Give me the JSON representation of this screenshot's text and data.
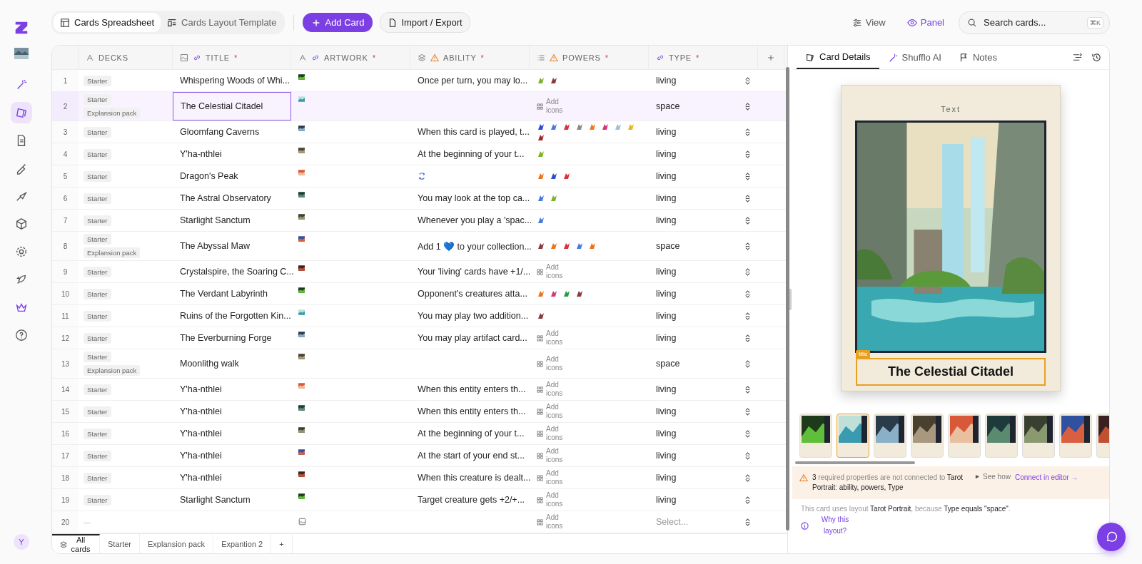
{
  "sidebar": {
    "items": [
      {
        "selected": false
      },
      {
        "selected": true
      },
      {
        "selected": false
      },
      {
        "selected": false
      },
      {
        "selected": false
      },
      {
        "selected": false
      },
      {
        "selected": false
      },
      {
        "selected": false
      },
      {
        "selected": false
      },
      {
        "selected": false
      }
    ],
    "avatar": "Y"
  },
  "views": [
    {
      "label": "Cards Spreadsheet",
      "selected": true
    },
    {
      "label": "Cards Layout Template",
      "selected": false
    }
  ],
  "add_button": "Add Card",
  "import_button": "Import / Export",
  "view_button": "View",
  "panel_button": {
    "label": "Panel",
    "on": true
  },
  "search": {
    "placeholder": "Search cards...",
    "shortcut": "⌘K"
  },
  "columns": [
    {
      "label": "DECKS"
    },
    {
      "label": "TITLE",
      "link": true,
      "warning": false,
      "required": "*"
    },
    {
      "label": "ARTWORK",
      "link": true,
      "warning": false,
      "required": "*"
    },
    {
      "label": "ABILITY",
      "link": false,
      "warning": true,
      "required": "*"
    },
    {
      "label": "POWERS",
      "link": false,
      "warning": true,
      "required": "*"
    },
    {
      "label": "TYPE",
      "link": true,
      "warning": false,
      "required": "*"
    }
  ],
  "rows": [
    {
      "n": "1",
      "decks": [
        "Starter"
      ],
      "title": "Whispering Woods of Whi...",
      "has_artwork": true,
      "ability": "Once per turn, you may lo...",
      "powers": [
        {
          "color": "#7cb32a"
        },
        {
          "color": "#8a3b3b"
        }
      ],
      "type": "living",
      "selected": false
    },
    {
      "n": "2",
      "decks": [
        "Starter",
        "Explansion pack"
      ],
      "title": "The Celestial Citadel",
      "has_artwork": true,
      "powers_hint": "Add icons",
      "type": "space",
      "selected": true
    },
    {
      "n": "3",
      "decks": [
        "Starter"
      ],
      "title": "Gloomfang Caverns",
      "has_artwork": true,
      "ability": "When this card is played, t...",
      "powers": [
        {
          "color": "#2d4bd8"
        },
        {
          "color": "#4a7be0"
        },
        {
          "color": "#d8323a"
        },
        {
          "color": "#8a8a8a"
        },
        {
          "color": "#f07a1a"
        },
        {
          "color": "#d4367a"
        },
        {
          "color": "#9fc0d8"
        },
        {
          "color": "#e8b820"
        },
        {
          "color": "#a0282a"
        }
      ],
      "type": "living",
      "selected": false
    },
    {
      "n": "4",
      "decks": [
        "Starter"
      ],
      "title": "Y'ha-nthlei",
      "has_artwork": true,
      "ability": "At the beginning of your t...",
      "powers": [
        {
          "color": "#7cb32a"
        }
      ],
      "type": "living",
      "selected": false
    },
    {
      "n": "5",
      "decks": [
        "Starter"
      ],
      "title": "Dragon's Peak",
      "has_artwork": true,
      "ability_icon": true,
      "powers": [
        {
          "color": "#f0731c"
        },
        {
          "color": "#2d4bd8"
        },
        {
          "color": "#d8323a"
        }
      ],
      "type": "living",
      "selected": false
    },
    {
      "n": "6",
      "decks": [
        "Starter"
      ],
      "title": "The Astral Observatory",
      "has_artwork": true,
      "ability": "You may look at the top ca...",
      "powers": [
        {
          "color": "#4a7be0"
        },
        {
          "color": "#7cb32a"
        }
      ],
      "type": "living",
      "selected": false
    },
    {
      "n": "7",
      "decks": [
        "Starter"
      ],
      "title": "Starlight Sanctum",
      "has_artwork": true,
      "ability": "Whenever you play a 'spac...",
      "powers": [
        {
          "color": "#4a7be0"
        }
      ],
      "type": "living",
      "selected": false
    },
    {
      "n": "8",
      "decks": [
        "Starter",
        "Explansion pack"
      ],
      "title": "The Abyssal Maw",
      "has_artwork": true,
      "ability": "Add 1 💙 to your collection...",
      "powers": [
        {
          "color": "#8a3b3b"
        },
        {
          "color": "#f0731c"
        },
        {
          "color": "#d8323a"
        },
        {
          "color": "#4a7be0"
        },
        {
          "color": "#f0731c"
        }
      ],
      "type": "space",
      "selected": false
    },
    {
      "n": "9",
      "decks": [
        "Starter"
      ],
      "title": "Crystalspire, the Soaring C...",
      "has_artwork": true,
      "ability": "Your 'living' cards have +1/...",
      "powers_hint": "Add icons",
      "type": "living",
      "selected": false
    },
    {
      "n": "10",
      "decks": [
        "Starter"
      ],
      "title": "The Verdant Labyrinth",
      "has_artwork": true,
      "ability": "Opponent's creatures atta...",
      "powers": [
        {
          "color": "#f0731c"
        },
        {
          "color": "#d4367a"
        },
        {
          "color": "#2a9a4a"
        },
        {
          "color": "#8a3b3b"
        }
      ],
      "type": "living",
      "selected": false
    },
    {
      "n": "11",
      "decks": [
        "Starter"
      ],
      "title": "Ruins of the Forgotten Kin...",
      "has_artwork": true,
      "ability": "You may play two addition...",
      "powers": [
        {
          "color": "#8a3b3b"
        }
      ],
      "type": "living",
      "selected": false
    },
    {
      "n": "12",
      "decks": [
        "Starter"
      ],
      "title": "The Everburning Forge",
      "has_artwork": true,
      "ability": "You may play artifact card...",
      "powers_hint": "Add icons",
      "type": "living",
      "selected": false
    },
    {
      "n": "13",
      "decks": [
        "Starter",
        "Explansion pack"
      ],
      "title": "Moonlithg walk",
      "has_artwork": true,
      "powers_hint": "Add icons",
      "type": "space",
      "selected": false
    },
    {
      "n": "14",
      "decks": [
        "Starter"
      ],
      "title": "Y'ha-nthlei",
      "has_artwork": true,
      "ability": "When this entity enters th...",
      "powers_hint": "Add icons",
      "type": "living",
      "selected": false
    },
    {
      "n": "15",
      "decks": [
        "Starter"
      ],
      "title": "Y'ha-nthlei",
      "has_artwork": true,
      "ability": "When this entity enters th...",
      "powers_hint": "Add icons",
      "type": "living",
      "selected": false
    },
    {
      "n": "16",
      "decks": [
        "Starter"
      ],
      "title": "Y'ha-nthlei",
      "has_artwork": true,
      "ability": "At the beginning of your t...",
      "powers_hint": "Add icons",
      "type": "living",
      "selected": false
    },
    {
      "n": "17",
      "decks": [
        "Starter"
      ],
      "title": "Y'ha-nthlei",
      "has_artwork": true,
      "ability": "At the start of your end st...",
      "powers_hint": "Add icons",
      "type": "living",
      "selected": false
    },
    {
      "n": "18",
      "decks": [
        "Starter"
      ],
      "title": "Y'ha-nthlei",
      "has_artwork": true,
      "ability": "When this creature is dealt...",
      "powers_hint": "Add icons",
      "type": "living",
      "selected": false
    },
    {
      "n": "19",
      "decks": [
        "Starter"
      ],
      "title": "Starlight Sanctum",
      "has_artwork": true,
      "ability": "Target creature gets +2/+...",
      "powers_hint": "Add icons",
      "type": "living",
      "selected": false
    },
    {
      "n": "20",
      "decks_empty": "—",
      "has_artwork": false,
      "powers_hint": "Add icons",
      "type_placeholder": "Select...",
      "selected": false
    }
  ],
  "deck_tabs": [
    {
      "label": "All cards",
      "selected": true
    },
    {
      "label": "Starter",
      "selected": false
    },
    {
      "label": "Explansion pack",
      "selected": false
    },
    {
      "label": "Expantion 2",
      "selected": false
    }
  ],
  "add_tab": "+",
  "panel": {
    "tabs": [
      {
        "label": "Card Details",
        "selected": true
      },
      {
        "label": "Shufflo AI",
        "selected": false
      },
      {
        "label": "Notes",
        "selected": false
      }
    ],
    "card": {
      "header": "Text",
      "field_tag": "title",
      "title": "The Celestial Citadel"
    },
    "thumbnails": [
      {
        "selected": false
      },
      {
        "selected": true
      },
      {
        "selected": false
      },
      {
        "selected": false
      },
      {
        "selected": false
      },
      {
        "selected": false
      },
      {
        "selected": false
      },
      {
        "selected": false
      },
      {
        "selected": false
      }
    ],
    "warning": {
      "text": "**3** required properties are not connected to **Tarot Portrait**: **ability, powers, Type**",
      "see_how": "See how",
      "connect": "Connect in editor →"
    },
    "footer": {
      "text": "This card uses layout **Tarot Portrait**, because **Type equals \"space\"**.",
      "why": "Why this layout?"
    }
  }
}
